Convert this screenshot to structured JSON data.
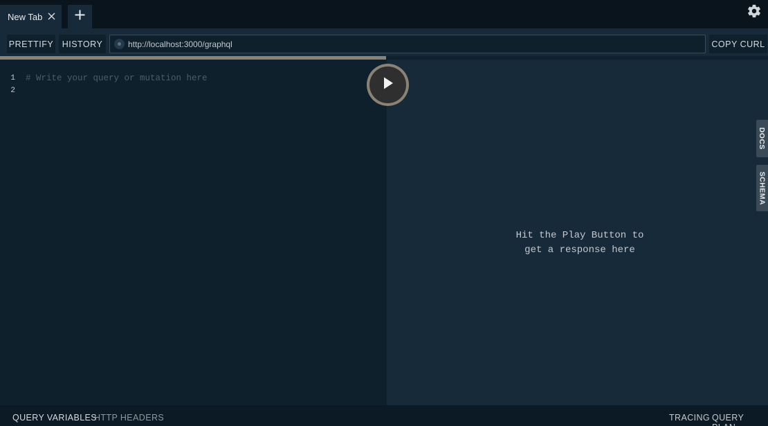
{
  "tabs": [
    {
      "label": "New Tab"
    }
  ],
  "toolbar": {
    "prettify_label": "PRETTIFY",
    "history_label": "HISTORY",
    "endpoint_url": "http://localhost:3000/graphql",
    "copy_curl_label": "COPY CURL"
  },
  "editor": {
    "line_numbers": [
      "1",
      "2"
    ],
    "placeholder_comment": "# Write your query or mutation here"
  },
  "result": {
    "hint_line1": "Hit the Play Button to",
    "hint_line2": "get a response here"
  },
  "side_tabs": {
    "docs_label": "DOCS",
    "schema_label": "SCHEMA"
  },
  "bottom": {
    "query_variables_label": "QUERY VARIABLES",
    "http_headers_label": "HTTP HEADERS",
    "tracing_label": "TRACING",
    "query_plan_label": "QUERY PLAN"
  },
  "icons": {
    "close": "close-icon",
    "add": "plus-icon",
    "settings": "gear-icon",
    "play": "play-icon"
  },
  "colors": {
    "accent_play": "#8a8272",
    "panel_dark": "#0f202d",
    "panel_light": "#172a3a"
  }
}
